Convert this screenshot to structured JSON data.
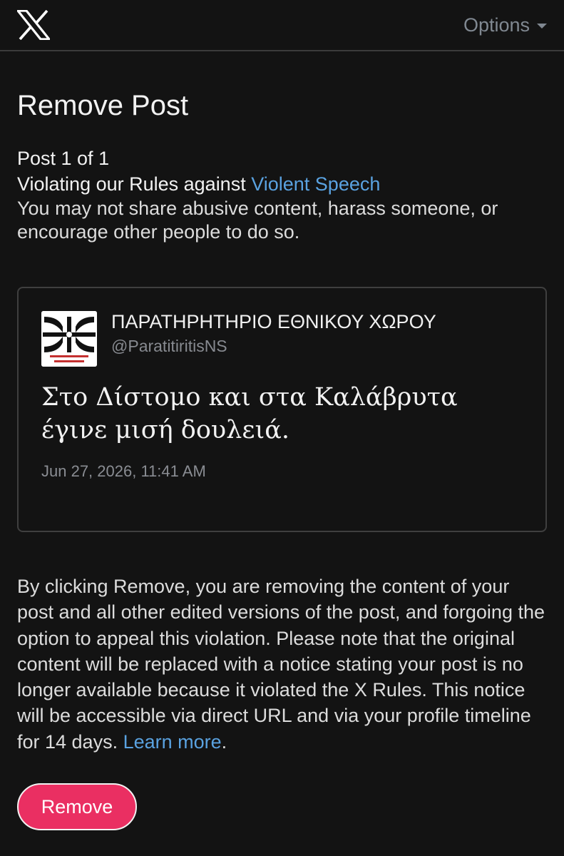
{
  "header": {
    "options_label": "Options"
  },
  "main": {
    "title": "Remove Post",
    "post_count": "Post 1 of 1",
    "violation_prefix": "Violating our Rules against ",
    "violation_rule": "Violent Speech",
    "violation_description": "You may not share abusive content, harass someone, or encourage other people to do so."
  },
  "post": {
    "author_name": "ΠΑΡΑΤΗΡΗΤΗΡΙΟ ΕΘΝΙΚΟΥ ΧΩΡΟΥ",
    "author_handle": "@ParatitiritisNS",
    "text": "Στο Δίστομο και στα Καλάβρυτα έγινε μισή δουλειά.",
    "timestamp": "Jun 27, 2026, 11:41 AM",
    "avatar_icon": "organization-logo-icon"
  },
  "notice": {
    "body": "By clicking Remove, you are removing the content of your post and all other edited versions of the post, and forgoing the option to appeal this violation. Please note that the original content will be replaced with a notice stating your post is no longer available because it violated the X Rules. This notice will be accessible via direct URL and via your profile timeline for 14 days.",
    "learn_more": "Learn more",
    "trailing_period": "."
  },
  "actions": {
    "remove_label": "Remove"
  },
  "colors": {
    "background": "#131313",
    "link": "#5aa2e0",
    "remove_button": "#ea2f62",
    "muted_text": "#808891"
  }
}
